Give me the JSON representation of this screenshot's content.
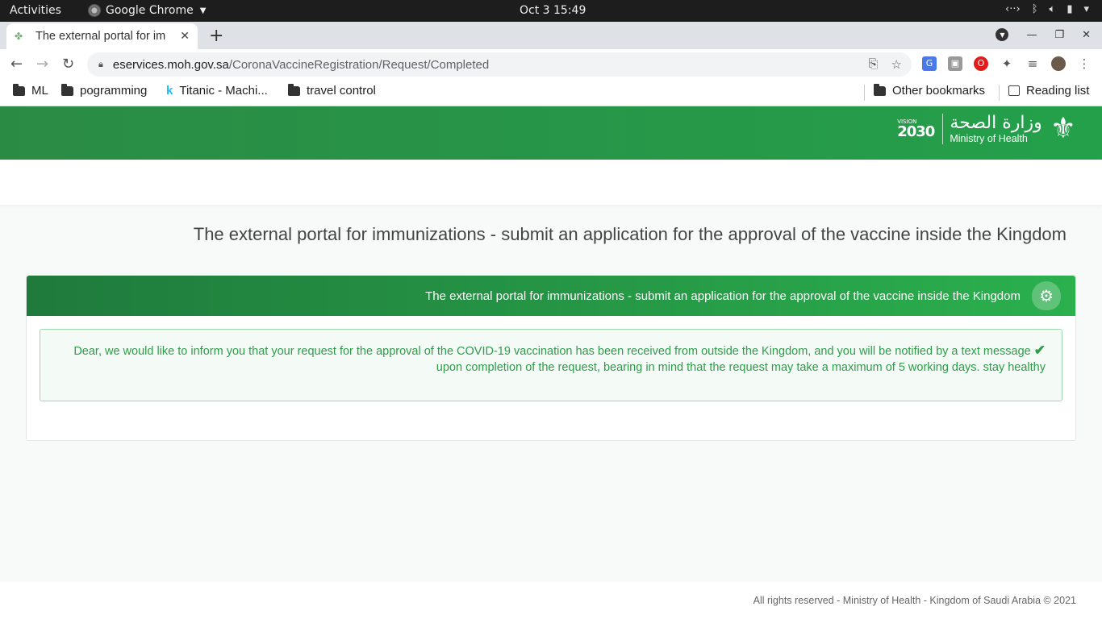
{
  "os": {
    "activities": "Activities",
    "app_name": "Google Chrome",
    "clock": "Oct 3  15:49"
  },
  "browser": {
    "tab_title": "The external portal for im",
    "url_host": "eservices.moh.gov.sa",
    "url_path": "/CoronaVaccineRegistration/Request/Completed",
    "bookmarks": [
      "ML",
      "pogramming",
      "Titanic - Machi...",
      "travel control"
    ],
    "other_bookmarks": "Other bookmarks",
    "reading_list": "Reading list"
  },
  "header": {
    "vision_label": "VISION",
    "vision_year": "2030",
    "ministry_ar": "وزارة الصحة",
    "ministry_en": "Ministry of Health"
  },
  "main": {
    "page_title": "The external portal for immunizations - submit an application for the approval of the vaccine inside the Kingdom",
    "card_title": "The external portal for immunizations - submit an application for the approval of the vaccine inside the Kingdom",
    "alert_line1": "Dear, we would like to inform you that your request for the approval of the COVID-19 vaccination has been received from outside the Kingdom, and you will be notified by a text message",
    "alert_line2": "upon completion of the request, bearing in mind that the request may take a maximum of 5 working days. stay healthy"
  },
  "footer": {
    "text": "All rights reserved - Ministry of Health - Kingdom of Saudi Arabia © 2021"
  },
  "colors": {
    "brand_green": "#24a04a",
    "alert_text": "#2e9c49"
  }
}
